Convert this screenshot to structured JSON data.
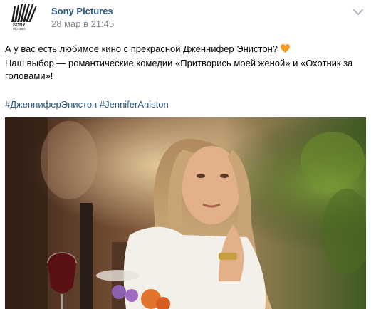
{
  "post": {
    "author": "Sony Pictures",
    "date": "28 мар в 21:45",
    "avatar": {
      "logo_word": "SONY",
      "logo_sub": "PICTURES"
    },
    "text_line1": "А у вас есть любимое кино с прекрасной Дженнифер Энистон?",
    "text_line2": "Наш выбор — романтические комедии «Притворись моей женой» и «Охотник за головами»!",
    "hashtags": [
      "#ДженниферЭнистон",
      "#JenniferAniston"
    ],
    "emoji": "orange-heart-icon",
    "colors": {
      "link": "#2a5885",
      "meta": "#828282",
      "heart": "#f59a23"
    }
  }
}
